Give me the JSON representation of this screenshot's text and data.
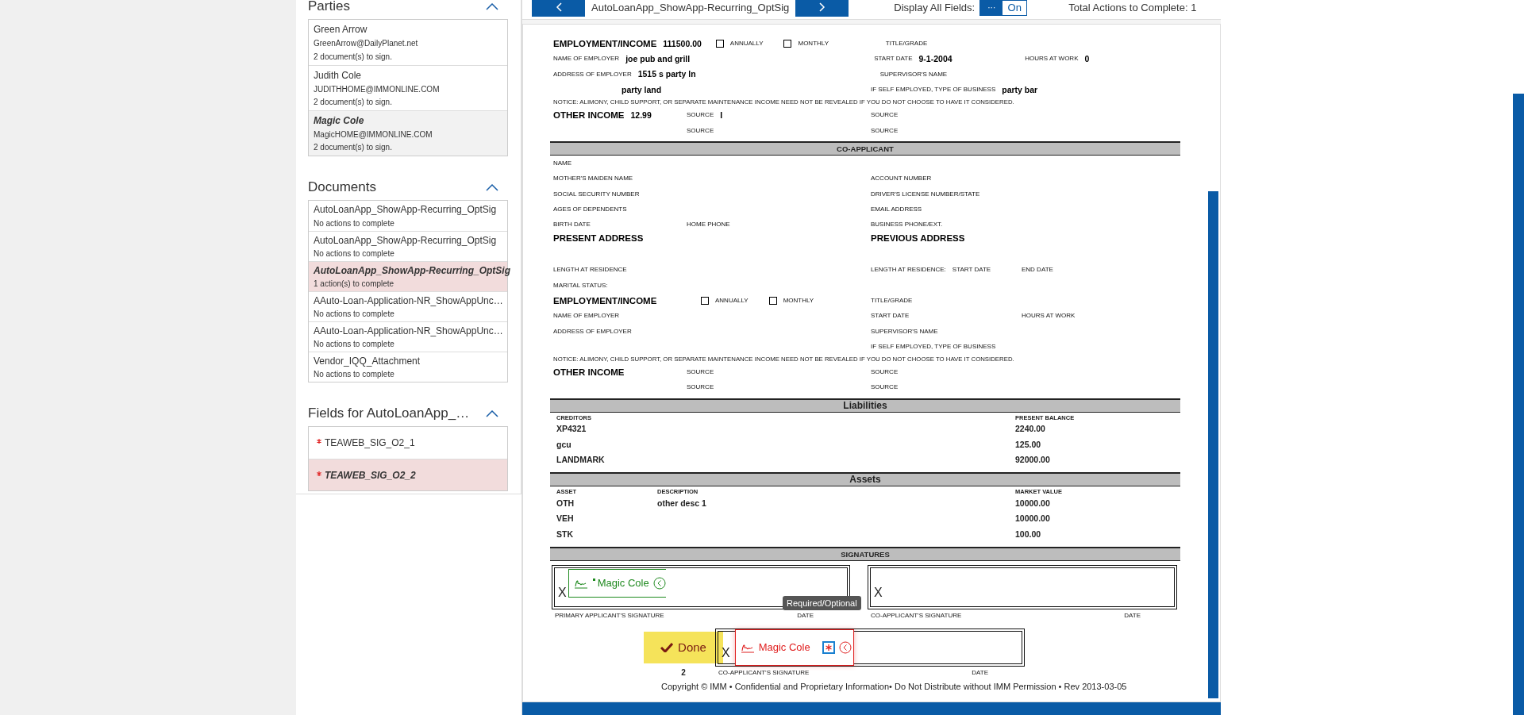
{
  "sidebar": {
    "sections": [
      {
        "kind": "parties",
        "title": "Parties",
        "expanded": true,
        "items": [
          {
            "name": "Green Arrow",
            "email": "GreenArrow@DailyPlanet.net",
            "status": "2 document(s) to sign.",
            "selected": false
          },
          {
            "name": "Judith Cole",
            "email": "JUDITHHOME@IMMONLINE.COM",
            "status": "2 document(s) to sign.",
            "selected": false
          },
          {
            "name": "Magic Cole",
            "email": "MagicHOME@IMMONLINE.COM",
            "status": "2 document(s) to sign.",
            "selected": true
          }
        ]
      },
      {
        "kind": "documents",
        "title": "Documents",
        "expanded": true,
        "items": [
          {
            "name": "AutoLoanApp_ShowApp-Recurring_OptSig",
            "status": "No actions to complete",
            "selected": false
          },
          {
            "name": "AutoLoanApp_ShowApp-Recurring_OptSig",
            "status": "No actions to complete",
            "selected": false
          },
          {
            "name": "AutoLoanApp_ShowApp-Recurring_OptSig",
            "status": "1 action(s) to complete",
            "selected": true
          },
          {
            "name": "AAuto-Loan-Application-NR_ShowAppUnc…",
            "status": "No actions to complete",
            "selected": false
          },
          {
            "name": "AAuto-Loan-Application-NR_ShowAppUnc…",
            "status": "No actions to complete",
            "selected": false
          },
          {
            "name": "Vendor_IQQ_Attachment",
            "status": "No actions to complete",
            "selected": false
          }
        ]
      },
      {
        "kind": "fields",
        "title": "Fields for AutoLoanApp_…",
        "expanded": true,
        "items": [
          {
            "name": "TEAWEB_SIG_O2_1",
            "required": true,
            "selected": false
          },
          {
            "name": "TEAWEB_SIG_O2_2",
            "required": true,
            "selected": true
          }
        ]
      }
    ]
  },
  "toolbar": {
    "document_title": "AutoLoanApp_ShowApp-Recurring_OptSig",
    "display_all_fields": {
      "label": "Display All Fields:",
      "handle": "···",
      "state_text": "On",
      "on": true
    },
    "total_actions": "Total Actions to Complete: 1"
  },
  "form": {
    "rows": [
      {
        "kind": "fields",
        "left": [
          {
            "kind": "heading",
            "text": "EMPLOYMENT/INCOME"
          },
          {
            "kind": "value",
            "text": "111500.00"
          }
        ],
        "middle": [
          {
            "kind": "checkbox",
            "text": "ANNUALLY",
            "checked": false
          },
          {
            "kind": "checkbox",
            "text": "MONTHLY",
            "checked": false
          }
        ],
        "right": [
          {
            "kind": "label",
            "text": "TITLE/GRADE"
          }
        ]
      },
      {
        "kind": "fields",
        "left": [
          {
            "kind": "label",
            "text": "NAME OF EMPLOYER"
          },
          {
            "kind": "value",
            "text": "joe pub and grill"
          }
        ],
        "right": [
          {
            "kind": "label",
            "text": "START DATE"
          },
          {
            "kind": "value",
            "text": "9-1-2004"
          }
        ],
        "far": [
          {
            "kind": "label",
            "text": "HOURS AT WORK"
          },
          {
            "kind": "value",
            "text": "0"
          }
        ]
      },
      {
        "kind": "fields",
        "left": [
          {
            "kind": "label",
            "text": "ADDRESS OF EMPLOYER"
          },
          {
            "kind": "value",
            "text": "1515 s party ln"
          }
        ],
        "right": [
          {
            "kind": "label",
            "text": "SUPERVISOR'S NAME"
          }
        ]
      },
      {
        "kind": "fields",
        "left": [
          {
            "kind": "continuation",
            "text": "party land"
          }
        ],
        "right": [
          {
            "kind": "label",
            "text": "IF SELF EMPLOYED, TYPE OF BUSINESS"
          },
          {
            "kind": "value",
            "text": "party bar"
          }
        ]
      },
      {
        "kind": "notice",
        "text": "NOTICE: ALIMONY, CHILD SUPPORT, OR SEPARATE MAINTENANCE INCOME NEED NOT BE REVEALED IF YOU DO NOT CHOOSE TO HAVE IT CONSIDERED."
      },
      {
        "kind": "fields",
        "left": [
          {
            "kind": "heading",
            "text": "OTHER INCOME"
          },
          {
            "kind": "value",
            "text": "12.99"
          }
        ],
        "middle": [
          {
            "kind": "label",
            "text": "SOURCE"
          },
          {
            "kind": "value",
            "text": "I"
          }
        ],
        "right": [
          {
            "kind": "label",
            "text": "SOURCE"
          }
        ]
      },
      {
        "kind": "fields",
        "middle": [
          {
            "kind": "label",
            "text": "SOURCE"
          }
        ],
        "right": [
          {
            "kind": "label",
            "text": "SOURCE"
          }
        ]
      },
      {
        "kind": "band",
        "text": "CO-APPLICANT"
      },
      {
        "kind": "fields",
        "left": [
          {
            "kind": "label",
            "text": "NAME"
          }
        ]
      },
      {
        "kind": "fields",
        "left": [
          {
            "kind": "label",
            "text": "MOTHER'S MAIDEN NAME"
          }
        ],
        "right": [
          {
            "kind": "label",
            "text": "ACCOUNT NUMBER"
          }
        ]
      },
      {
        "kind": "fields",
        "left": [
          {
            "kind": "label",
            "text": "SOCIAL SECURITY NUMBER"
          }
        ],
        "right": [
          {
            "kind": "label",
            "text": "DRIVER'S LICENSE NUMBER/STATE"
          }
        ]
      },
      {
        "kind": "fields",
        "left": [
          {
            "kind": "label",
            "text": "AGES OF DEPENDENTS"
          }
        ],
        "right": [
          {
            "kind": "label",
            "text": "EMAIL ADDRESS"
          }
        ]
      },
      {
        "kind": "fields",
        "left": [
          {
            "kind": "label",
            "text": "BIRTH DATE"
          }
        ],
        "middle": [
          {
            "kind": "label",
            "text": "HOME PHONE"
          }
        ],
        "right": [
          {
            "kind": "label",
            "text": "BUSINESS PHONE/EXT."
          }
        ]
      },
      {
        "kind": "fields",
        "left": [
          {
            "kind": "heading",
            "text": "PRESENT ADDRESS"
          }
        ],
        "right": [
          {
            "kind": "heading",
            "text": "PREVIOUS ADDRESS"
          }
        ]
      },
      {
        "kind": "fields",
        "left": [
          {
            "kind": "label",
            "text": "LENGTH AT RESIDENCE"
          }
        ],
        "right": [
          {
            "kind": "label",
            "text": "LENGTH AT RESIDENCE:"
          },
          {
            "kind": "label",
            "text": "START DATE"
          }
        ],
        "far": [
          {
            "kind": "label",
            "text": "END DATE"
          }
        ]
      },
      {
        "kind": "fields",
        "left": [
          {
            "kind": "label",
            "text": "MARITAL STATUS:"
          }
        ]
      },
      {
        "kind": "fields",
        "left": [
          {
            "kind": "heading",
            "text": "EMPLOYMENT/INCOME"
          }
        ],
        "middle": [
          {
            "kind": "checkbox",
            "text": "ANNUALLY",
            "checked": false
          },
          {
            "kind": "checkbox",
            "text": "MONTHLY",
            "checked": false
          }
        ],
        "right": [
          {
            "kind": "label",
            "text": "TITLE/GRADE"
          }
        ]
      },
      {
        "kind": "fields",
        "left": [
          {
            "kind": "label",
            "text": "NAME OF EMPLOYER"
          }
        ],
        "right": [
          {
            "kind": "label",
            "text": "START DATE"
          }
        ],
        "far": [
          {
            "kind": "label",
            "text": "HOURS AT WORK"
          }
        ]
      },
      {
        "kind": "fields",
        "left": [
          {
            "kind": "label",
            "text": "ADDRESS OF EMPLOYER"
          }
        ],
        "right": [
          {
            "kind": "label",
            "text": "SUPERVISOR'S NAME"
          }
        ]
      },
      {
        "kind": "fields",
        "right": [
          {
            "kind": "label",
            "text": "IF SELF EMPLOYED, TYPE OF BUSINESS"
          }
        ]
      },
      {
        "kind": "notice",
        "text": "NOTICE: ALIMONY, CHILD SUPPORT, OR SEPARATE MAINTENANCE INCOME NEED NOT BE REVEALED IF YOU DO NOT CHOOSE TO HAVE IT CONSIDERED."
      },
      {
        "kind": "fields",
        "left": [
          {
            "kind": "heading",
            "text": "OTHER INCOME"
          }
        ],
        "middle": [
          {
            "kind": "label",
            "text": "SOURCE"
          }
        ],
        "right": [
          {
            "kind": "label",
            "text": "SOURCE"
          }
        ]
      },
      {
        "kind": "fields",
        "middle": [
          {
            "kind": "label",
            "text": "SOURCE"
          }
        ],
        "right": [
          {
            "kind": "label",
            "text": "SOURCE"
          }
        ]
      },
      {
        "kind": "band",
        "text": "Liabilities",
        "large": true
      },
      {
        "kind": "table",
        "columns": [
          "CREDITORS",
          "PRESENT BALANCE"
        ],
        "rows": [
          [
            "XP4321",
            "2240.00"
          ],
          [
            "gcu",
            "125.00"
          ],
          [
            "LANDMARK",
            "92000.00"
          ]
        ]
      },
      {
        "kind": "band",
        "text": "Assets",
        "large": true
      },
      {
        "kind": "table",
        "columns": [
          "ASSET",
          "DESCRIPTION",
          "MARKET VALUE"
        ],
        "rows": [
          [
            "OTH",
            "other desc 1",
            "10000.00"
          ],
          [
            "VEH",
            "",
            "10000.00"
          ],
          [
            "STK",
            "",
            "100.00"
          ]
        ]
      },
      {
        "kind": "band",
        "text": "SIGNATURES"
      }
    ],
    "signature_row": [
      {
        "mark": "X",
        "role": "PRIMARY APPLICANT'S SIGNATURE",
        "date": "DATE",
        "tag": {
          "signed": true,
          "name": "Magic Cole",
          "required": true
        }
      },
      {
        "mark": "X",
        "role": "CO-APPLICANT'S SIGNATURE",
        "date": "DATE"
      }
    ],
    "signature_pending": {
      "mark": "X",
      "role": "CO-APPLICANT'S SIGNATURE",
      "date": "DATE",
      "tag": {
        "signed": false,
        "name": "Magic Cole",
        "required": true
      },
      "tooltip": "Required/Optional",
      "done_button": "Done",
      "done_count": "2"
    },
    "copyright": "Copyright © IMM • Confidential and Proprietary Information• Do Not Distribute without IMM Permission • Rev 2013-03-05"
  }
}
